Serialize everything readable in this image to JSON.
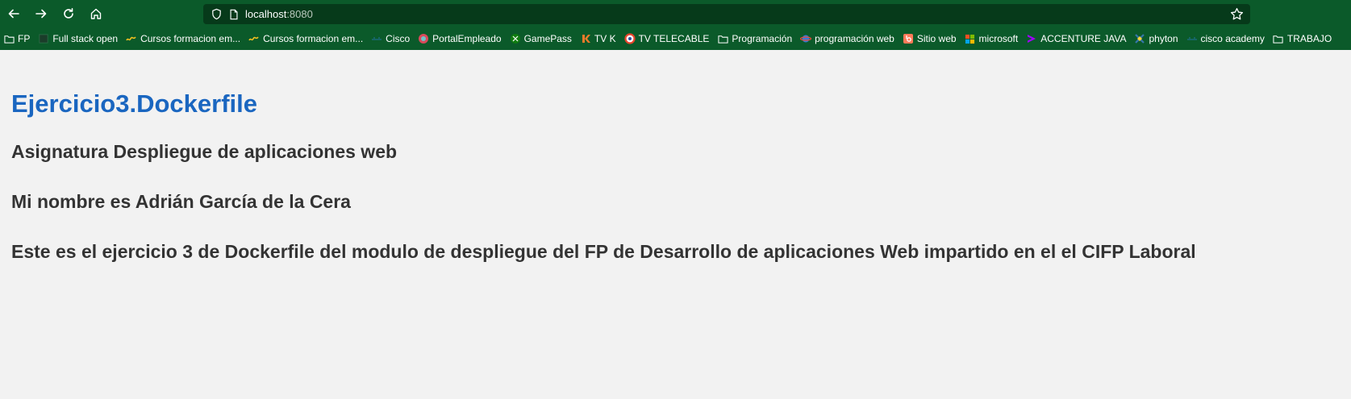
{
  "browser": {
    "url_host": "localhost",
    "url_port": ":8080",
    "bookmarks": [
      {
        "label": "FP",
        "icon": "folder-icon"
      },
      {
        "label": "Full stack open",
        "icon": "square-icon"
      },
      {
        "label": "Cursos formacion em...",
        "icon": "wave-icon"
      },
      {
        "label": "Cursos formacion em...",
        "icon": "wave-icon"
      },
      {
        "label": "Cisco",
        "icon": "cisco-icon"
      },
      {
        "label": "PortalEmpleado",
        "icon": "globe-icon"
      },
      {
        "label": "GamePass",
        "icon": "xbox-icon"
      },
      {
        "label": "TV K",
        "icon": "tvk-icon"
      },
      {
        "label": "TV TELECABLE",
        "icon": "ring-icon"
      },
      {
        "label": "Programación",
        "icon": "folder-icon"
      },
      {
        "label": "programación web",
        "icon": "planet-icon"
      },
      {
        "label": "Sitio web",
        "icon": "hubspot-icon"
      },
      {
        "label": "microsoft",
        "icon": "microsoft-icon"
      },
      {
        "label": "ACCENTURE JAVA",
        "icon": "accenture-icon"
      },
      {
        "label": "phyton",
        "icon": "python-icon"
      },
      {
        "label": "cisco academy",
        "icon": "cisco-icon"
      },
      {
        "label": "TRABAJO",
        "icon": "folder-icon"
      }
    ]
  },
  "page": {
    "title": "Ejercicio3.Dockerfile",
    "subject": "Asignatura Despliegue de aplicaciones web",
    "name": "Mi nombre es Adrián García de la Cera",
    "description": "Este es el ejercicio 3 de Dockerfile del modulo de despliegue del FP de Desarrollo de aplicaciones Web impartido en el el CIFP Laboral"
  }
}
